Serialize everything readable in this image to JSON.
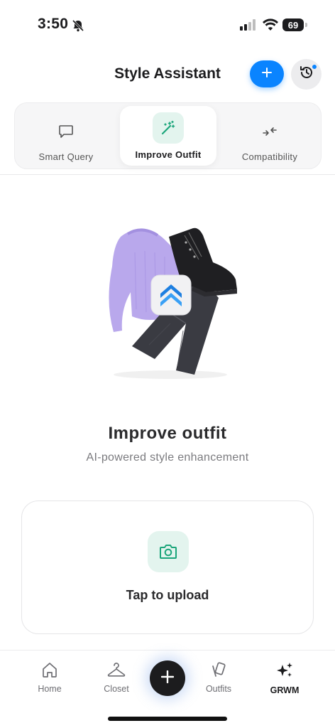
{
  "status_bar": {
    "time": "3:50",
    "battery": "69"
  },
  "header": {
    "title": "Style Assistant"
  },
  "tabs": [
    {
      "label": "Smart Query",
      "icon": "chat-bubble-icon"
    },
    {
      "label": "Improve Outfit",
      "icon": "magic-wand-icon",
      "selected": true
    },
    {
      "label": "Compatibility",
      "icon": "compare-arrows-icon"
    }
  ],
  "main": {
    "title": "Improve outfit",
    "subtitle": "AI-powered style enhancement"
  },
  "upload": {
    "label": "Tap to upload",
    "icon": "camera-icon"
  },
  "bottom_nav": [
    {
      "label": "Home",
      "icon": "home-icon"
    },
    {
      "label": "Closet",
      "icon": "hanger-icon"
    },
    {
      "label": "Outfits",
      "icon": "cards-icon"
    },
    {
      "label": "GRWM",
      "icon": "sparkles-icon",
      "selected": true
    }
  ],
  "colors": {
    "accent": "#0a84ff",
    "green": "#1aa57a",
    "tint": "#e3f4ee"
  }
}
